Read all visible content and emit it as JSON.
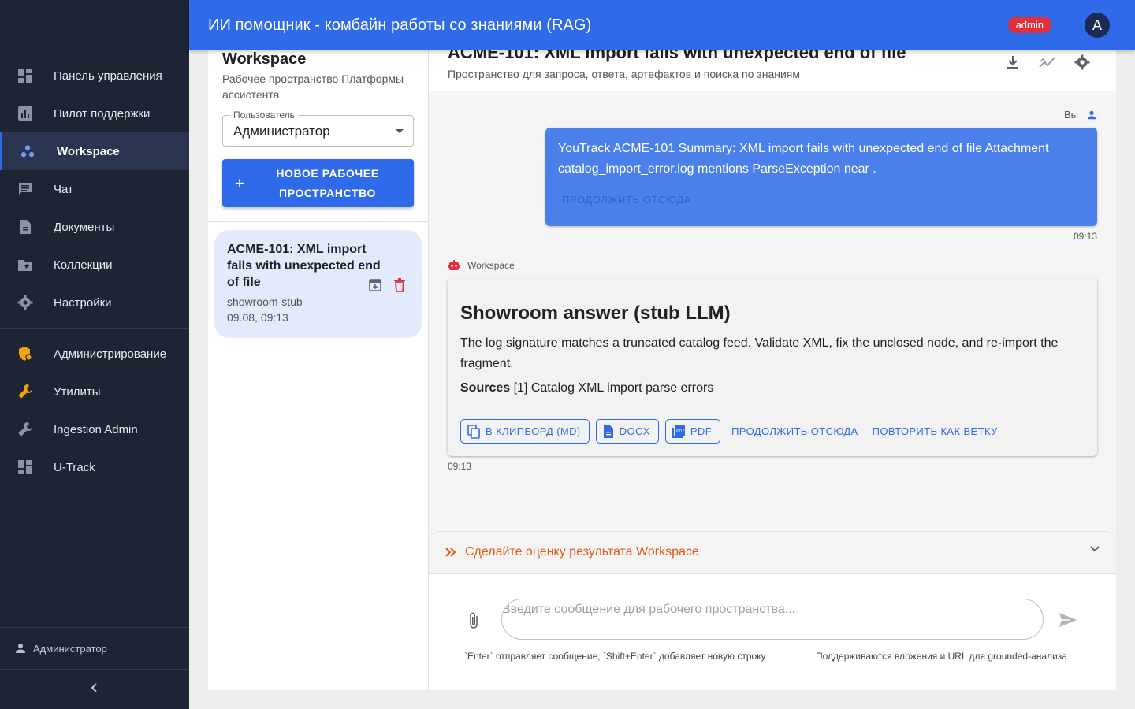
{
  "app": {
    "title": "ИИ помощник - комбайн работы со знаниями (RAG)",
    "role_badge": "admin",
    "avatar_letter": "A"
  },
  "colors": {
    "accent": "#2f6ae8",
    "sidebar": "#1d2433",
    "danger": "#e0313b",
    "warning": "#e05a14"
  },
  "sidebar": {
    "items": [
      {
        "label": "Панель управления",
        "icon": "dashboard-icon"
      },
      {
        "label": "Пилот поддержки",
        "icon": "bar-chart-icon"
      },
      {
        "label": "Workspace",
        "icon": "workspaces-icon",
        "active": true
      },
      {
        "label": "Чат",
        "icon": "chat-icon"
      },
      {
        "label": "Документы",
        "icon": "document-icon"
      },
      {
        "label": "Коллекции",
        "icon": "folder-star-icon"
      },
      {
        "label": "Настройки",
        "icon": "gear-icon"
      },
      {
        "label": "Администрирование",
        "icon": "admin-shield-icon"
      },
      {
        "label": "Утилиты",
        "icon": "wrench-icon"
      },
      {
        "label": "Ingestion Admin",
        "icon": "wrench-icon"
      },
      {
        "label": "U-Track",
        "icon": "dashboard-icon"
      }
    ],
    "user": "Администратор"
  },
  "workspace_panel": {
    "title": "Workspace",
    "subtitle": "Рабочее пространство Платформы ассистента",
    "user_select": {
      "label": "Пользователь",
      "value": "Администратор"
    },
    "new_button": "НОВОЕ РАБОЧЕЕ ПРОСТРАНСТВО",
    "items": [
      {
        "title": "ACME-101: XML import fails with unexpected end of file",
        "source": "showroom-stub",
        "date": "09.08, 09:13"
      }
    ]
  },
  "chat": {
    "title": "ACME-101: XML import fails with unexpected end of file",
    "subtitle": "Пространство для запроса, ответа, артефактов и поиска по знаниям",
    "user_label": "Вы",
    "user_message": "YouTrack ACME-101 Summary: XML import fails with unexpected end of file Attachment catalog_import_error.log mentions ParseException near .",
    "continue_label": "ПРОДОЛЖИТЬ ОТСЮДА",
    "user_time": "09:13",
    "bot_label": "Workspace",
    "answer_title": "Showroom answer (stub LLM)",
    "answer_text": "The log signature matches a truncated catalog feed. Validate XML, fix the unclosed node, and re-import the fragment.",
    "sources_label": "Sources",
    "sources_text": "[1] Catalog XML import parse errors",
    "actions": {
      "clipboard": "В КЛИПБОРД (MD)",
      "docx": "DOCX",
      "pdf": "PDF",
      "continue": "ПРОДОЛЖИТЬ ОТСЮДА",
      "branch": "ПОВТОРИТЬ КАК ВЕТКУ"
    },
    "bot_time": "09:13",
    "rating_label": "Сделайте оценку результата Workspace",
    "input_placeholder": "Введите сообщение для рабочего пространства...",
    "hint_left": "`Enter` отправляет сообщение, `Shift+Enter` добавляет новую строку",
    "hint_right": "Поддерживаются вложения и URL для grounded-анализа"
  }
}
